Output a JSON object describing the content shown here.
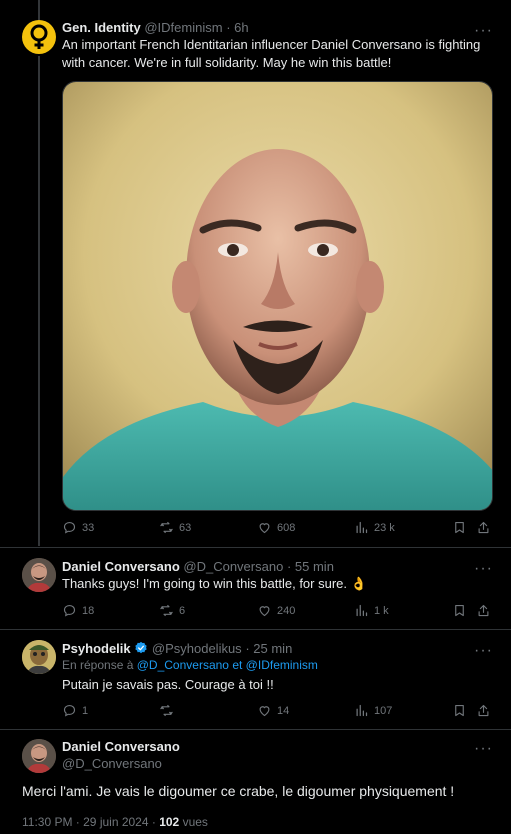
{
  "tweet1": {
    "name": "Gen. Identity",
    "handle": "@IDfeminism",
    "time": "6h",
    "text": "An important French Identitarian influencer Daniel Conversano is fighting with cancer. We're in full solidarity. May he win this battle!",
    "replies": "33",
    "retweets": "63",
    "likes": "608",
    "views": "23 k"
  },
  "tweet2": {
    "name": "Daniel Conversano",
    "handle": "@D_Conversano",
    "time": "55 min",
    "text": "Thanks guys! I'm going to win this battle, for sure. 👌",
    "replies": "18",
    "retweets": "6",
    "likes": "240",
    "views": "1 k"
  },
  "tweet3": {
    "name": "Psyhodelik",
    "handle": "@Psyhodelikus",
    "time": "25 min",
    "reply_prefix": "En réponse à",
    "mention1": "@D_Conversano",
    "mention_joiner": "et",
    "mention2": "@IDfeminism",
    "text": "Putain je savais pas. Courage à toi !!",
    "replies": "1",
    "retweets": "",
    "likes": "14",
    "views": "107"
  },
  "main_tweet": {
    "name": "Daniel Conversano",
    "handle": "@D_Conversano",
    "text": "Merci l'ami. Je vais le digoumer ce crabe, le digoumer physiquement !",
    "timestamp": "11:30 PM · 29 juin 2024 ·",
    "view_count": "102",
    "view_label": "vues"
  },
  "separator": "·",
  "more_glyph": "···",
  "colors": {
    "background": "#000000",
    "text": "#e7e9ea",
    "muted": "#71767b",
    "accent": "#1d9bf0",
    "divider": "#2f3336",
    "venus_yellow": "#f4c20d"
  }
}
